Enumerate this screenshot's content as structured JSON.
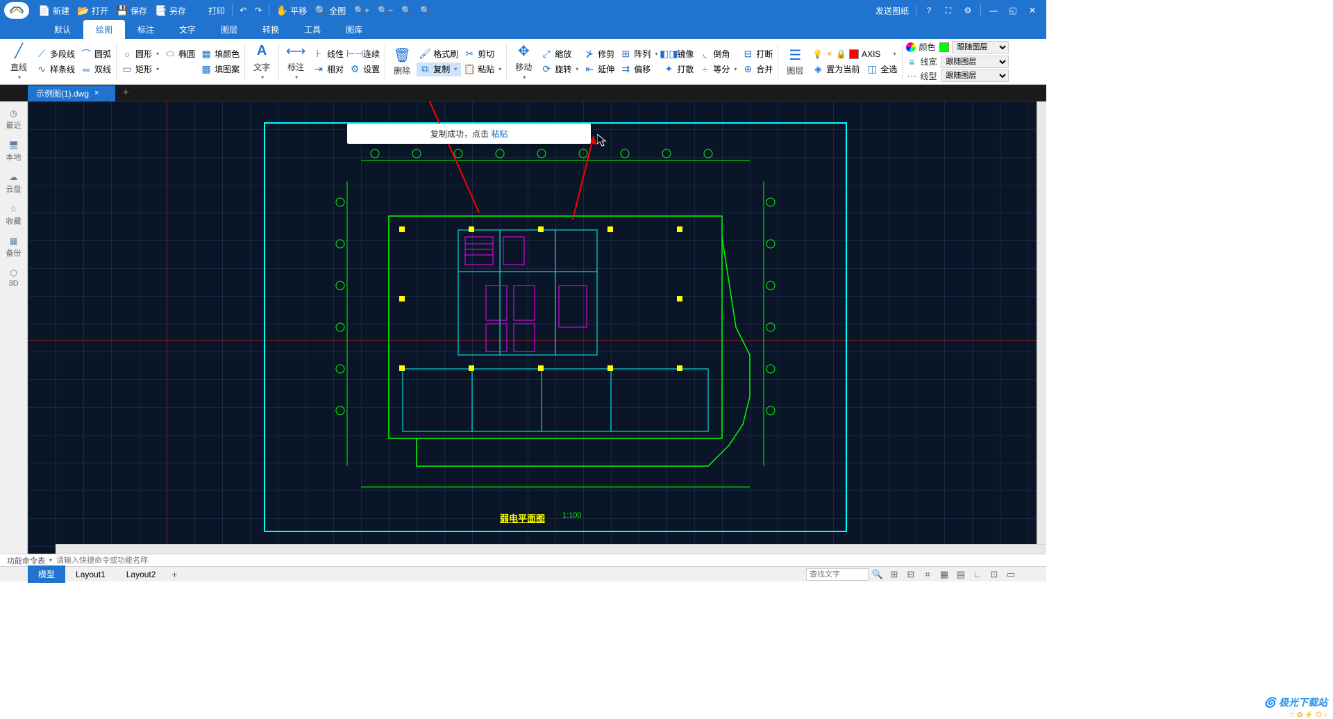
{
  "titlebar": {
    "new": "新建",
    "open": "打开",
    "save": "保存",
    "saveas": "另存",
    "print": "打印",
    "send": "发送图纸",
    "pan": "平移",
    "fit": "全图"
  },
  "menus": [
    "默认",
    "绘图",
    "标注",
    "文字",
    "图层",
    "转换",
    "工具",
    "图库"
  ],
  "active_menu": 1,
  "ribbon": {
    "line": "直线",
    "polyline": "多段线",
    "arc": "圆弧",
    "spline": "样条线",
    "dline": "双线",
    "circle": "圆形",
    "ellipse": "椭圆",
    "rect": "矩形",
    "fillcolor": "填颜色",
    "fillpattern": "填图案",
    "text": "文字",
    "dim": "标注",
    "linear": "线性",
    "continuous": "连续",
    "relative": "相对",
    "settings": "设置",
    "delete": "删除",
    "formatbrush": "格式刷",
    "copy": "复制",
    "cut": "剪切",
    "paste": "粘贴",
    "move": "移动",
    "scale": "缩放",
    "rotate": "旋转",
    "trim": "修剪",
    "extend": "延伸",
    "array": "阵列",
    "offset": "偏移",
    "mirror": "镜像",
    "explode": "打散",
    "fillet": "倒角",
    "equal": "等分",
    "break": "打断",
    "merge": "合并",
    "layers": "图层",
    "axis": "AXIS",
    "setcurrent": "置为当前",
    "selectall": "全选",
    "color": "颜色",
    "linewidth": "线宽",
    "linetype": "线型",
    "follow": "跟随图层"
  },
  "file_tab": "示例图(1).dwg",
  "sidebar": [
    {
      "icon": "◷",
      "label": "最近"
    },
    {
      "icon": "🖥",
      "label": "本地"
    },
    {
      "icon": "☁",
      "label": "云盘"
    },
    {
      "icon": "☆",
      "label": "收藏"
    },
    {
      "icon": "▦",
      "label": "备份"
    },
    {
      "icon": "⬡",
      "label": "3D"
    }
  ],
  "toast": {
    "text": "复制成功，点击 ",
    "link": "粘贴"
  },
  "drawing": {
    "title": "弱电平面图",
    "scale": "1:100"
  },
  "command": {
    "label": "功能命令表",
    "placeholder": "请输入快捷命令或功能名称"
  },
  "layouts": [
    "模型",
    "Layout1",
    "Layout2"
  ],
  "active_layout": 0,
  "search_placeholder": "查找文字",
  "watermark": "极光下载站",
  "watermark2": "☆ ✿ ⚡ の ♪"
}
